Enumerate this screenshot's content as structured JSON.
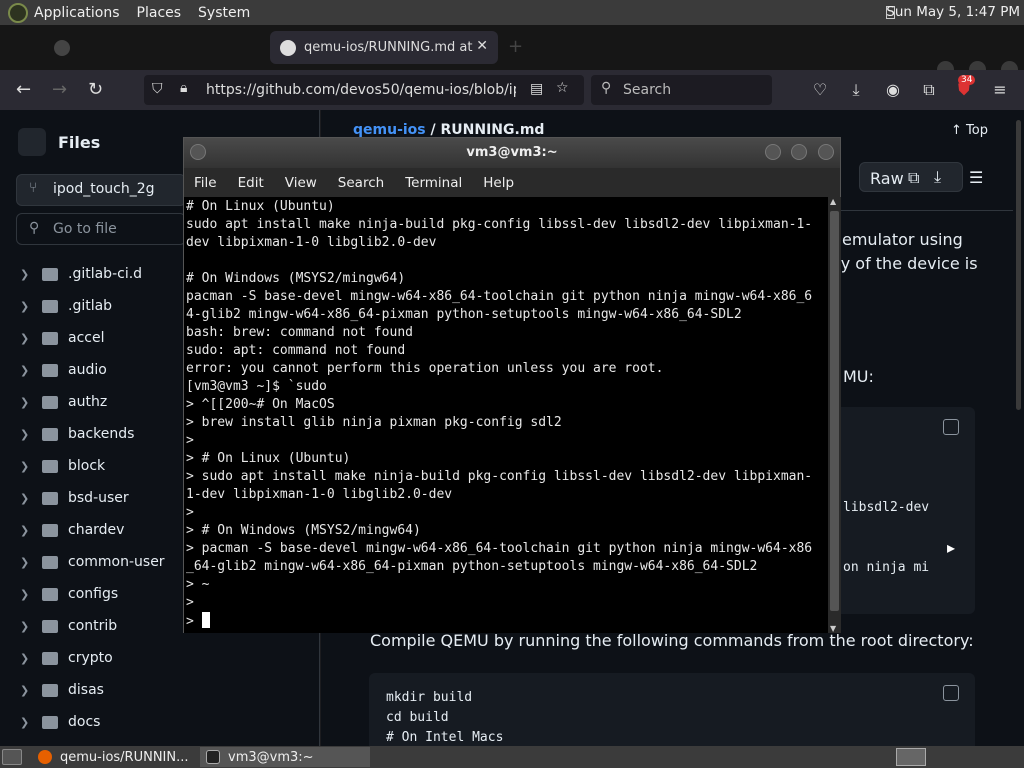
{
  "topbar": {
    "menus": [
      "Applications",
      "Places",
      "System"
    ],
    "clock": "Sun May  5,  1:47 PM"
  },
  "browser": {
    "tabs": [
      {
        "label": "",
        "active": false
      },
      {
        "label": "qemu-ios/RUNNING.md at",
        "active": true
      }
    ],
    "url": "https://github.com/devos50/qemu-ios/blob/ipod_",
    "search_placeholder": "Search",
    "badge_count": "34"
  },
  "github": {
    "files_title": "Files",
    "branch": "ipod_touch_2g",
    "go_to_file_placeholder": "Go to file",
    "tree": [
      ".gitlab-ci.d",
      ".gitlab",
      "accel",
      "audio",
      "authz",
      "backends",
      "block",
      "bsd-user",
      "chardev",
      "common-user",
      "configs",
      "contrib",
      "crypto",
      "disas",
      "docs"
    ],
    "breadcrumb_repo": "qemu-ios",
    "breadcrumb_sep": " / ",
    "breadcrumb_file": "RUNNING.md",
    "top_link": "Top",
    "raw_label": "Raw",
    "prose_line1": "emulator using",
    "prose_line2": "ity of the device is",
    "prose_line3": "MU:",
    "code1_frag1": "libsdl2-dev",
    "code1_frag2": "on ninja mi",
    "compile_text": "Compile QEMU by running the following commands from the root directory:",
    "code2": [
      "mkdir build",
      "cd build",
      "# On Intel Macs"
    ]
  },
  "terminal": {
    "title": "vm3@vm3:~",
    "menu": [
      "File",
      "Edit",
      "View",
      "Search",
      "Terminal",
      "Help"
    ],
    "lines": [
      "# On Linux (Ubuntu)",
      "sudo apt install make ninja-build pkg-config libssl-dev libsdl2-dev libpixman-1-",
      "dev libpixman-1-0 libglib2.0-dev",
      "",
      "# On Windows (MSYS2/mingw64)",
      "pacman -S base-devel mingw-w64-x86_64-toolchain git python ninja mingw-w64-x86_6",
      "4-glib2 mingw-w64-x86_64-pixman python-setuptools mingw-w64-x86_64-SDL2",
      "bash: brew: command not found",
      "sudo: apt: command not found",
      "error: you cannot perform this operation unless you are root.",
      "[vm3@vm3 ~]$ `sudo",
      "> ^[[200~# On MacOS",
      "> brew install glib ninja pixman pkg-config sdl2",
      ">",
      "> # On Linux (Ubuntu)",
      "> sudo apt install make ninja-build pkg-config libssl-dev libsdl2-dev libpixman-",
      "1-dev libpixman-1-0 libglib2.0-dev",
      ">",
      "> # On Windows (MSYS2/mingw64)",
      "> pacman -S base-devel mingw-w64-x86_64-toolchain git python ninja mingw-w64-x86",
      "_64-glib2 mingw-w64-x86_64-pixman python-setuptools mingw-w64-x86_64-SDL2",
      "> ~",
      ">"
    ],
    "prompt_last": "> "
  },
  "taskbar": {
    "tasks": [
      "qemu-ios/RUNNIN...",
      "vm3@vm3:~"
    ]
  }
}
